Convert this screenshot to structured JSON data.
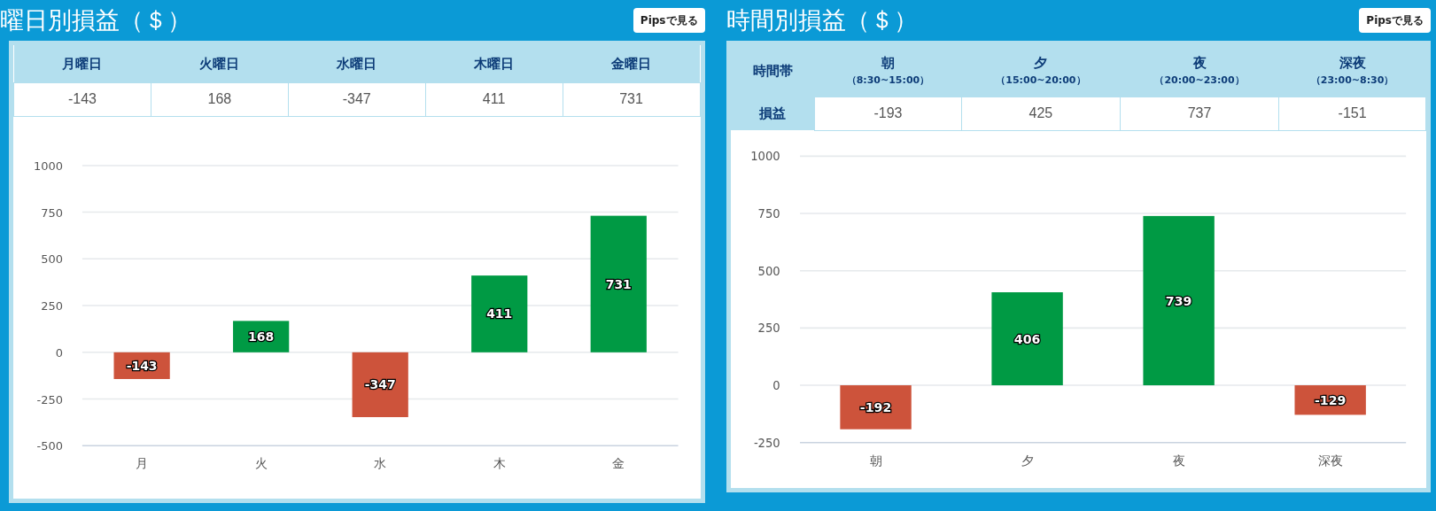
{
  "panels": [
    {
      "title": "曜日別損益（＄）",
      "button": "Pipsで見る",
      "table": {
        "columns": [
          {
            "label": "月曜日"
          },
          {
            "label": "火曜日"
          },
          {
            "label": "水曜日"
          },
          {
            "label": "木曜日"
          },
          {
            "label": "金曜日"
          }
        ],
        "rows": [
          {
            "cells": [
              "-143",
              "168",
              "-347",
              "411",
              "731"
            ]
          }
        ]
      },
      "chart_data": {
        "type": "bar",
        "categories": [
          "月",
          "火",
          "水",
          "木",
          "金"
        ],
        "stacked": true,
        "grid": true,
        "value_labels": [
          "-143",
          "168",
          "-347",
          "411",
          "731"
        ],
        "ylim": [
          -500,
          1000
        ],
        "yticks": [
          -500,
          -250,
          0,
          250,
          500,
          750,
          1000
        ],
        "series": [
          {
            "color": "#009a44",
            "values": [
              null,
              168,
              null,
              411,
              731
            ]
          },
          {
            "color": "#cd533b",
            "values": [
              -143,
              null,
              -347,
              null,
              null
            ]
          }
        ]
      }
    },
    {
      "title": "時間別損益（＄）",
      "button": "Pipsで見る",
      "table": {
        "corner": "時間帯",
        "columns": [
          {
            "label": "朝",
            "range": "（8:30~15:00）"
          },
          {
            "label": "夕",
            "range": "（15:00~20:00）"
          },
          {
            "label": "夜",
            "range": "（20:00~23:00）"
          },
          {
            "label": "深夜",
            "range": "（23:00~8:30）"
          }
        ],
        "rows": [
          {
            "label": "損益",
            "cells": [
              "-193",
              "425",
              "737",
              "-151"
            ]
          }
        ]
      },
      "chart_data": {
        "type": "bar",
        "categories": [
          "朝",
          "夕",
          "夜",
          "深夜"
        ],
        "stacked": true,
        "grid": true,
        "value_labels": [
          "-192",
          "406",
          "739",
          "-129"
        ],
        "ylim": [
          -250,
          1000
        ],
        "yticks": [
          -250,
          0,
          250,
          500,
          750,
          1000
        ],
        "series": [
          {
            "color": "#009a44",
            "values": [
              null,
              406,
              739,
              null
            ]
          },
          {
            "color": "#cd533b",
            "values": [
              -192,
              null,
              null,
              -129
            ]
          }
        ]
      }
    }
  ]
}
